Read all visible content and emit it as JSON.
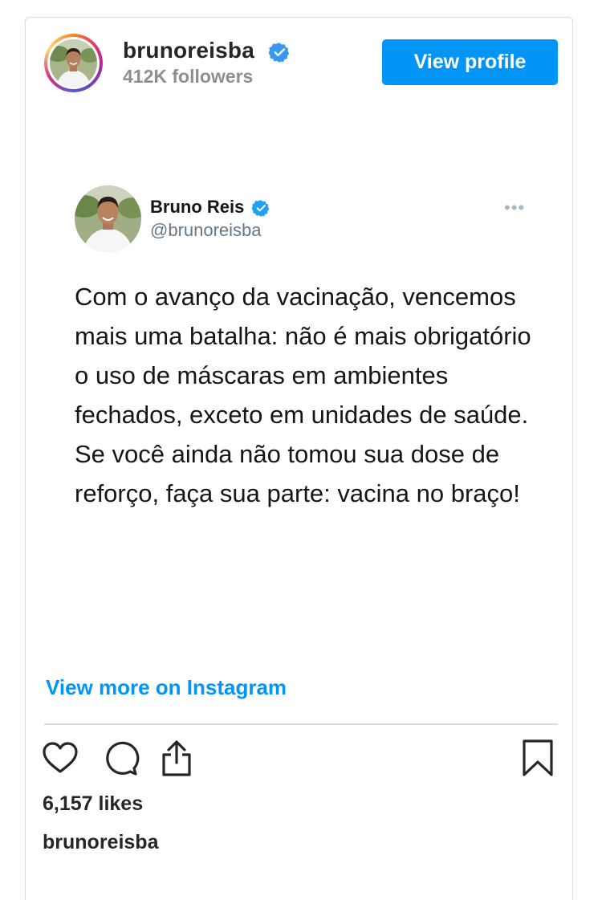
{
  "colors": {
    "primary_blue": "#0095f6",
    "text_dark": "#262626",
    "text_gray": "#8e8e8e",
    "verified_blue": "#3897f0",
    "twitter_verified": "#1da1f2",
    "border": "#dbdbdb"
  },
  "header": {
    "username": "brunoreisba",
    "followers": "412K followers",
    "view_profile_label": "View profile"
  },
  "tweet": {
    "display_name": "Bruno Reis",
    "handle": "@brunoreisba",
    "more_label": "•••",
    "text": "Com o avanço da vacinação, vencemos mais uma batalha: não é mais obrigatório o uso de máscaras em ambientes fechados, exceto em unidades de saúde. Se você ainda não tomou sua dose de reforço, faça sua parte: vacina no braço!"
  },
  "footer": {
    "view_more_label": "View more on Instagram",
    "likes": "6,157 likes",
    "caption_username": "brunoreisba"
  },
  "icons": [
    "heart-icon",
    "comment-icon",
    "share-icon",
    "bookmark-icon",
    "verified-badge-icon"
  ]
}
